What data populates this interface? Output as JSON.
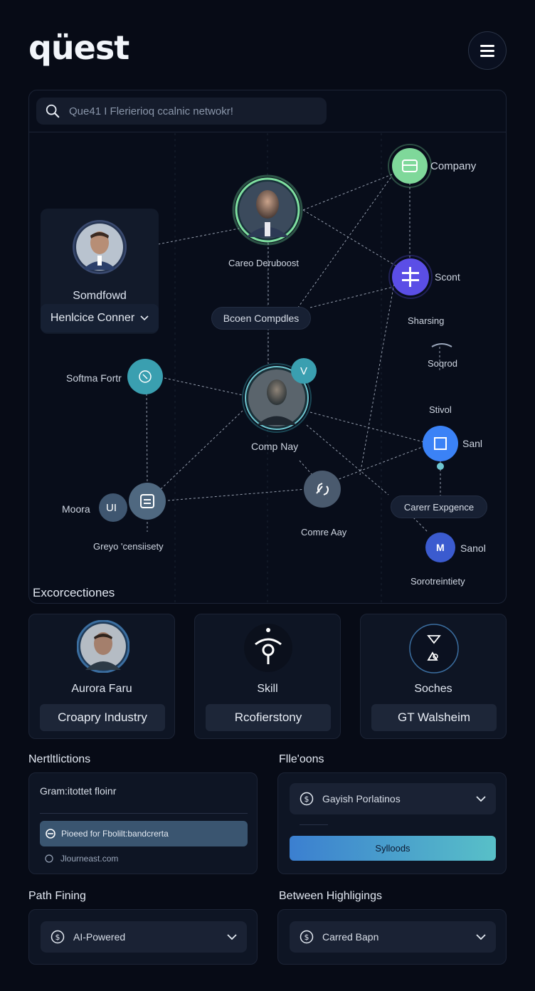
{
  "app": {
    "logo": "qüest"
  },
  "search": {
    "placeholder": "Que41 I Flerierioq ccalnic netwokr!"
  },
  "graph": {
    "profile": {
      "name": "Somdfowd",
      "select_label": "Henlcice Conner"
    },
    "labels": {
      "company": "Company",
      "career_dashboard": "Careo Deruboost",
      "scont": "Scont",
      "sharsing": "Sharsing",
      "brown_companies": "Bcoen Compdles",
      "soqrod": "Soqrod",
      "stivol": "Stivol",
      "softma_fortr": "Softma Fortr",
      "comp_nay": "Comp Nay",
      "sanl": "Sanl",
      "moora": "Moora",
      "ui": "UI",
      "greyo_censiiety": "Greyo 'censiisety",
      "comre_aay": "Comre Aay",
      "career_expence": "Carerr Expgence",
      "sanol": "Sanol",
      "v_badge": "V",
      "m_badge": "M",
      "sorotreintiety": "Sorotreintiety"
    }
  },
  "explorations": {
    "title": "Excorcectiones",
    "cards": [
      {
        "label": "Aurora Faru",
        "button": "Croapry Industry"
      },
      {
        "label": "Skill",
        "button": "Rcofierstony"
      },
      {
        "label": "Soches",
        "button": "GT Walsheim"
      }
    ]
  },
  "notifications": {
    "title": "Nertltlictions",
    "heading": "Gram:itottet floinr",
    "highlight": "Pioeed for Fbolilt:bandcrerta",
    "link": "Jlourneast.com"
  },
  "filters": {
    "title": "Flle'oons",
    "dropdown": "Gayish Porlatinos",
    "button": "Sylloods"
  },
  "path_finding": {
    "title": "Path Fining",
    "dropdown": "AI-Powered"
  },
  "between": {
    "title": "Between Highligings",
    "dropdown": "Carred Bapn"
  },
  "colors": {
    "background": "#070b16",
    "accent_green": "#7fe0a0",
    "accent_purple": "#5b4ee6",
    "accent_teal": "#3a9fb0",
    "accent_blue": "#3b82f6",
    "gradient_start": "#3b7fd0",
    "gradient_end": "#58c0c8"
  }
}
